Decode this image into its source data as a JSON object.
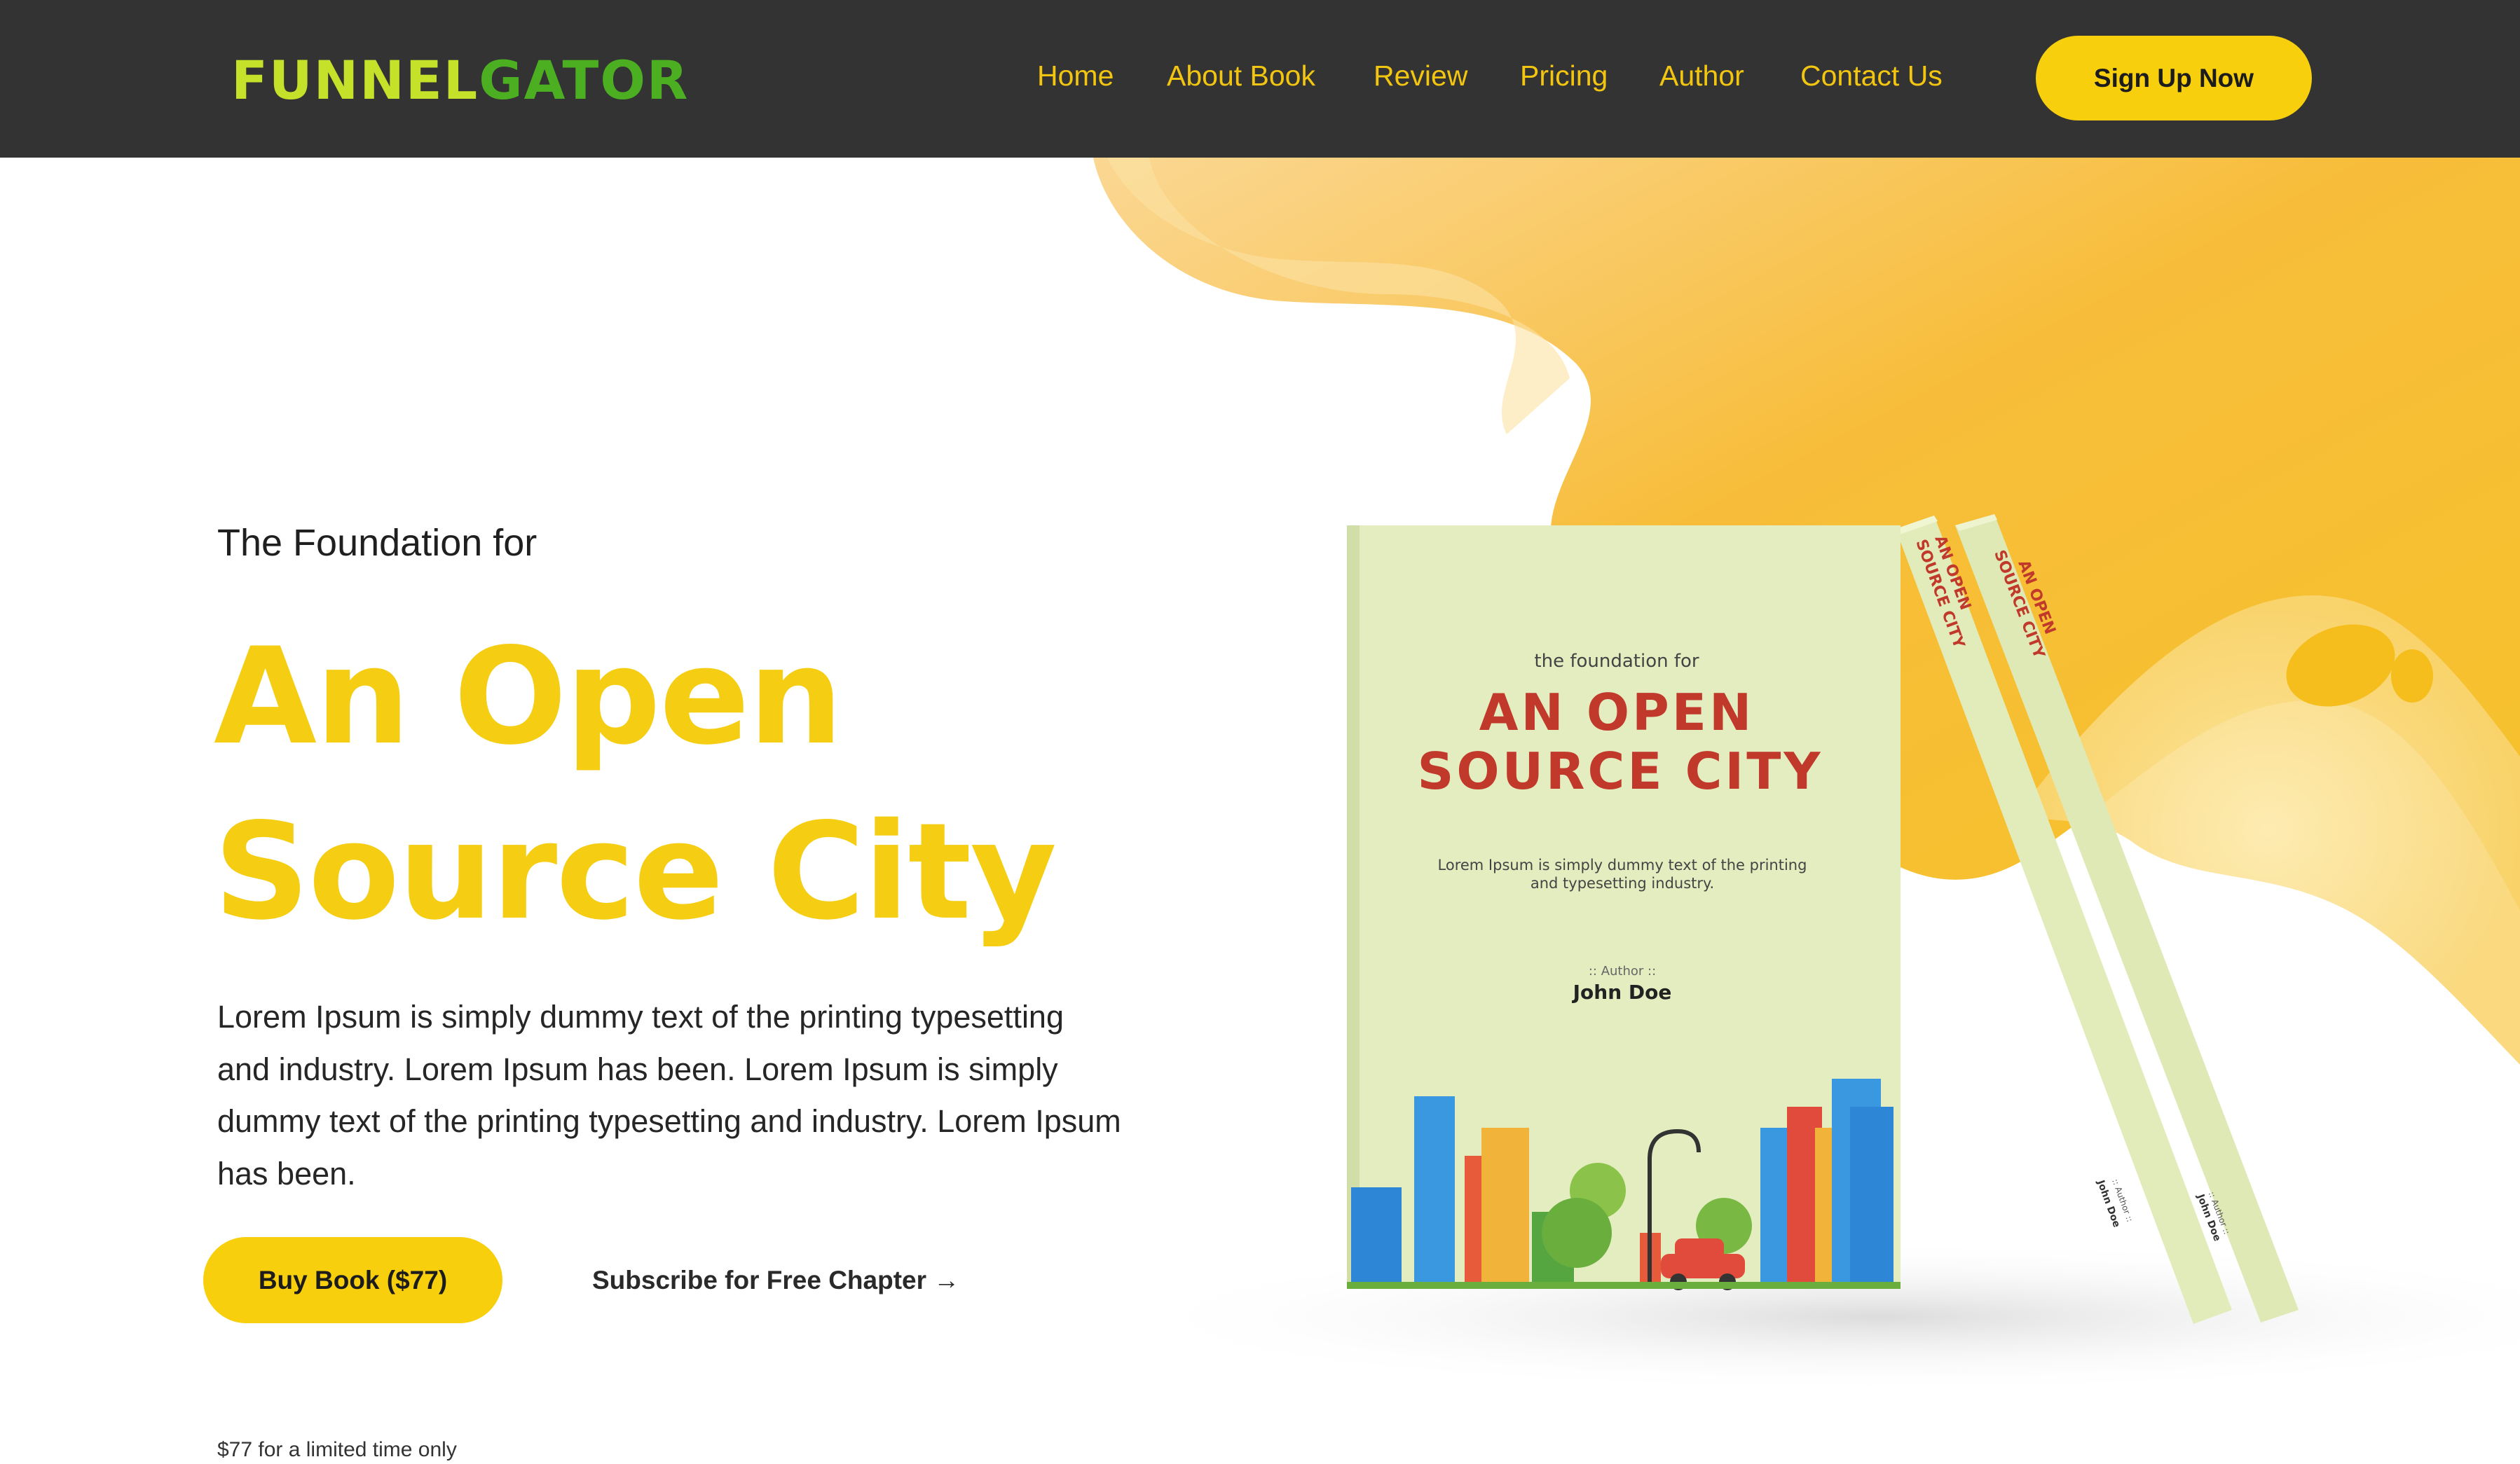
{
  "header": {
    "logo_part1": "FUNNEL",
    "logo_part2": "GATOR",
    "nav": [
      "Home",
      "About Book",
      "Review",
      "Pricing",
      "Author",
      "Contact Us"
    ],
    "cta": "Sign Up Now"
  },
  "hero": {
    "eyebrow": "The Foundation for",
    "headline_line1": "An Open",
    "headline_line2": "Source City",
    "description": "Lorem Ipsum is simply dummy text of the printing typesetting and industry. Lorem Ipsum has been. Lorem Ipsum is simply dummy text of the printing typesetting and industry. Lorem Ipsum has been.",
    "buy_button": "Buy Book ($77)",
    "subscribe_link": "Subscribe for Free Chapter →",
    "limited_note": "$77 for a limited time only"
  },
  "book": {
    "cover_kicker": "the foundation for",
    "cover_title_1": "AN OPEN",
    "cover_title_2": "SOURCE CITY",
    "cover_blurb_1": "Lorem Ipsum is simply dummy text of the printing",
    "cover_blurb_2": "and typesetting industry.",
    "cover_author_label": ":: Author ::",
    "cover_author": "John Doe",
    "spine_title_1": "AN OPEN",
    "spine_title_2": "SOURCE CITY",
    "spine_author": ":: Author ::",
    "spine_author_name": "John Doe"
  },
  "colors": {
    "nav_bg": "#333333",
    "accent_yellow": "#f7cf0c",
    "headline_yellow": "#f5cd12",
    "cover_bg": "#e3edc0",
    "cover_title_red": "#c0392b"
  }
}
